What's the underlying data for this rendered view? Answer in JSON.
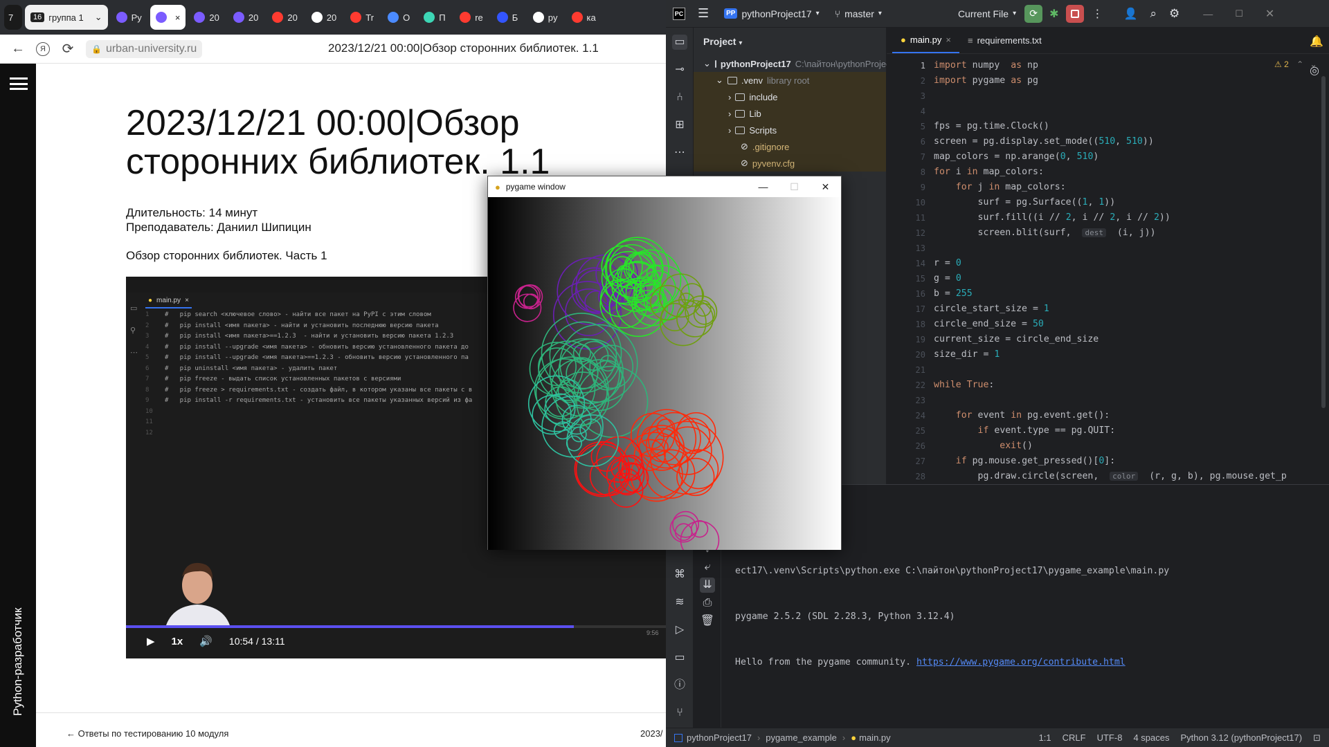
{
  "browser": {
    "tabs": [
      {
        "label": "7",
        "active": false,
        "type": "counter"
      },
      {
        "label": "16",
        "group": "группа 1",
        "type": "group"
      },
      {
        "label": "Py",
        "color": "#7b5cff"
      },
      {
        "label": "",
        "color": "#7b5cff",
        "active": true
      },
      {
        "label": "20",
        "color": "#7b5cff"
      },
      {
        "label": "20",
        "color": "#7b5cff"
      },
      {
        "label": "20",
        "color": "#ff3b30"
      },
      {
        "label": "20",
        "color": "#ffffff"
      },
      {
        "label": "Tr",
        "color": "#ff3b30"
      },
      {
        "label": "O",
        "color": "#4b8bff"
      },
      {
        "label": "П",
        "color": "#3dd6b5"
      },
      {
        "label": "re",
        "color": "#ff3b30"
      },
      {
        "label": "Б",
        "color": "#3355ff"
      },
      {
        "label": "py",
        "color": "#ffffff"
      },
      {
        "label": "ка",
        "color": "#ff3b30"
      }
    ],
    "close_symbol": "×",
    "url": "urban-university.ru",
    "page_title": "2023/12/21 00:00|Обзор сторонних библиотек. 1.1",
    "lesson_title": "2023/12/21 00:00|Обзор сторонних библиотек. 1.1",
    "duration": "Длительность: 14 минут",
    "teacher": "Преподаватель: Даниил Шипицин",
    "lesson_subtitle": "Обзор сторонних библиотек. Часть 1",
    "side_label": "Python-разработчик",
    "video": {
      "tab": "main.py",
      "code_lines": [
        "#   pip search <ключевое слово> - найти все пакет на PyPI с этим словом",
        "#   pip install <имя пакета> - найти и установить последнюю версию пакета",
        "#   pip install <имя пакета>==1.2.3  - найти и установить версию пакета 1.2.3",
        "#   pip install --upgrade <имя пакета> - обновить версию установленного пакета до",
        "#   pip install --upgrade <имя пакета>==1.2.3 - обновить версию установленного па",
        "#   pip uninstall <имя пакета> - удалить пакет",
        "#   pip freeze - выдать список установленных пакетов с версиями",
        "#   pip freeze > requirements.txt - создать файл, в котором указаны все пакеты с в",
        "#   pip install -r requirements.txt - установить все пакеты указанных версий из фа",
        "",
        "",
        ""
      ],
      "progress": 0.83,
      "speed": "1x",
      "time": "10:54 / 13:11",
      "duration_right": "9:56"
    },
    "prev_link": "← Ответы по тестированию 10 модуля",
    "next_date": "2023/"
  },
  "ide": {
    "project_name": "pythonProject17",
    "project_badge": "PP",
    "branch": "master",
    "run_config": "Current File",
    "project_panel_title": "Project",
    "tree": [
      {
        "label": "pythonProject17",
        "extra": "C:\\пайтон\\pythonProject",
        "level": 0,
        "type": "folder",
        "bold": true
      },
      {
        "label": ".venv",
        "extra": "library root",
        "level": 1,
        "type": "folder",
        "hl": true
      },
      {
        "label": "include",
        "level": 2,
        "type": "folder",
        "hl": true
      },
      {
        "label": "Lib",
        "level": 2,
        "type": "folder",
        "hl": true
      },
      {
        "label": "Scripts",
        "level": 2,
        "type": "folder",
        "hl": true
      },
      {
        "label": ".gitignore",
        "level": 2,
        "type": "file",
        "hl": true
      },
      {
        "label": "pyvenv.cfg",
        "level": 2,
        "type": "file",
        "hl": true
      }
    ],
    "editor_tabs": [
      {
        "label": "main.py",
        "active": true
      },
      {
        "label": "requirements.txt",
        "active": false
      }
    ],
    "warnings": "2",
    "code": [
      "import numpy  as np",
      "import pygame as pg",
      "",
      "",
      "fps = pg.time.Clock()",
      "screen = pg.display.set_mode((510, 510))",
      "map_colors = np.arange(0, 510)",
      "for i in map_colors:",
      "    for j in map_colors:",
      "        surf = pg.Surface((1, 1))",
      "        surf.fill((i // 2, i // 2, i // 2))",
      "        screen.blit(surf,  dest  (i, j))",
      "",
      "r = 0",
      "g = 0",
      "b = 255",
      "circle_start_size = 1",
      "circle_end_size = 50",
      "current_size = circle_end_size",
      "size_dir = 1",
      "",
      "while True:",
      "",
      "    for event in pg.event.get():",
      "        if event.type == pg.QUIT:",
      "            exit()",
      "    if pg.mouse.get_pressed()[0]:",
      "        pg.draw.circle(screen,  color  (r, g, b), pg.mouse.get_p"
    ],
    "run_output": [
      "ect17\\.venv\\Scripts\\python.exe C:\\пайтон\\pythonProject17\\pygame_example\\main.py",
      "pygame 2.5.2 (SDL 2.28.3, Python 3.12.4)",
      "Hello from the pygame community. "
    ],
    "run_link": "https://www.pygame.org/contribute.html",
    "status": {
      "crumbs": [
        "pythonProject17",
        "pygame_example",
        "main.py"
      ],
      "position": "1:1",
      "line_sep": "CRLF",
      "encoding": "UTF-8",
      "indent": "4 spaces",
      "interpreter": "Python 3.12 (pythonProject17)"
    }
  },
  "pygame_window": {
    "title": "pygame window"
  },
  "colors": {
    "accent": "#3574f0",
    "video_progress": "#5b4ff0"
  }
}
